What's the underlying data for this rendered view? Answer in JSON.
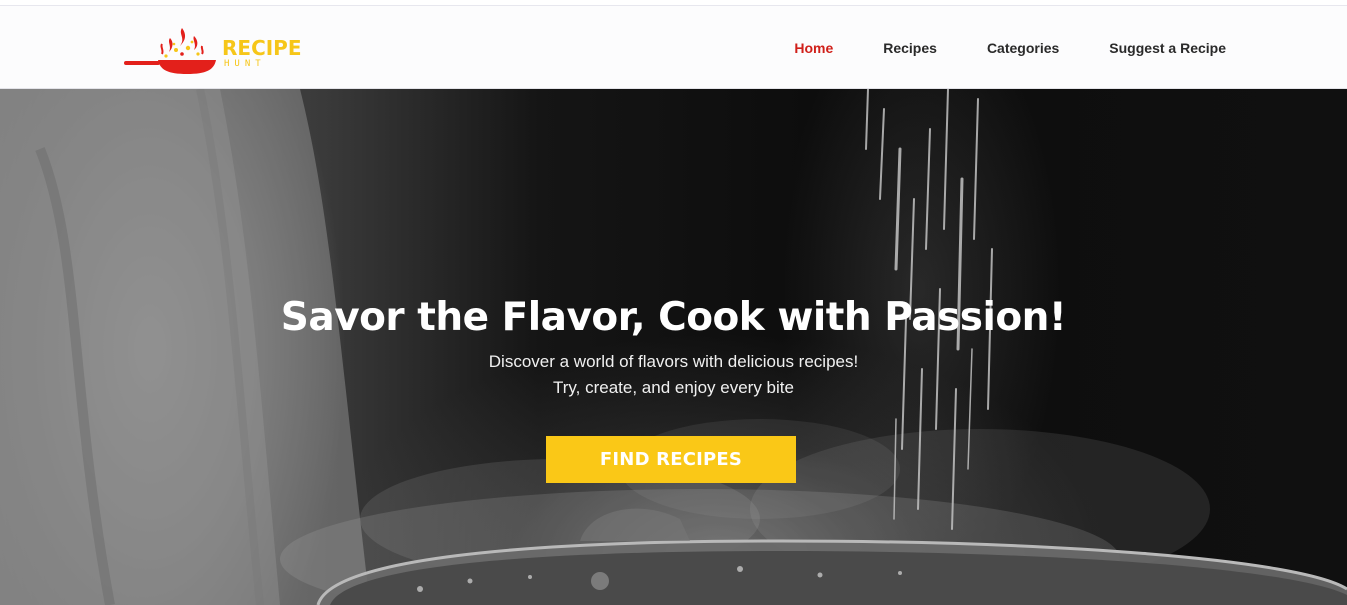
{
  "header": {
    "logo": {
      "word": "RECIPE",
      "sub": "HUNT"
    },
    "nav": [
      {
        "label": "Home",
        "active": true
      },
      {
        "label": "Recipes",
        "active": false
      },
      {
        "label": "Categories",
        "active": false
      },
      {
        "label": "Suggest a Recipe",
        "active": false
      }
    ]
  },
  "hero": {
    "title": "Savor the Flavor, Cook with Passion!",
    "subtitle_line1": "Discover a world of flavors with delicious recipes!",
    "subtitle_line2": "Try, create, and enjoy every bite",
    "cta_label": "FIND RECIPES",
    "background_image": "chef-sprinkling-salt-over-steaming-pan"
  },
  "colors": {
    "brand_red": "#d0201a",
    "brand_yellow": "#f6c619",
    "cta_yellow": "#fac817",
    "nav_text": "#2a2a2a",
    "hero_text": "#ffffff"
  }
}
